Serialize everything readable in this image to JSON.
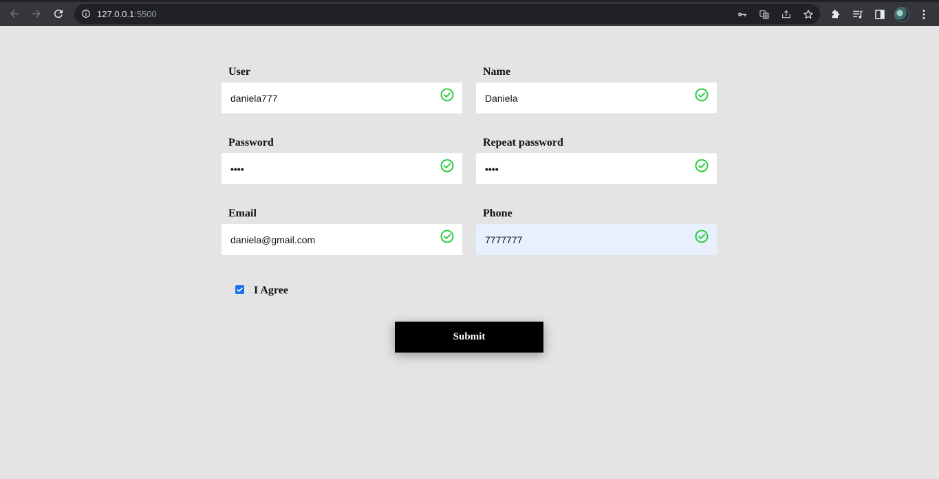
{
  "browser": {
    "url_host": "127.0.0.1",
    "url_port": ":5500"
  },
  "form": {
    "user": {
      "label": "User",
      "value": "daniela777"
    },
    "name": {
      "label": "Name",
      "value": "Daniela"
    },
    "password": {
      "label": "Password",
      "value": "••••"
    },
    "repeat_password": {
      "label": "Repeat password",
      "value": "••••"
    },
    "email": {
      "label": "Email",
      "value": "daniela@gmail.com"
    },
    "phone": {
      "label": "Phone",
      "value": "7777777"
    },
    "agree": {
      "label": "I Agree",
      "checked": true
    },
    "submit_label": "Submit"
  },
  "colors": {
    "valid_check": "#2ecc40",
    "page_bg": "#e4e4e4",
    "autofill_bg": "#e8f0fe",
    "checkbox": "#1a73e8"
  }
}
